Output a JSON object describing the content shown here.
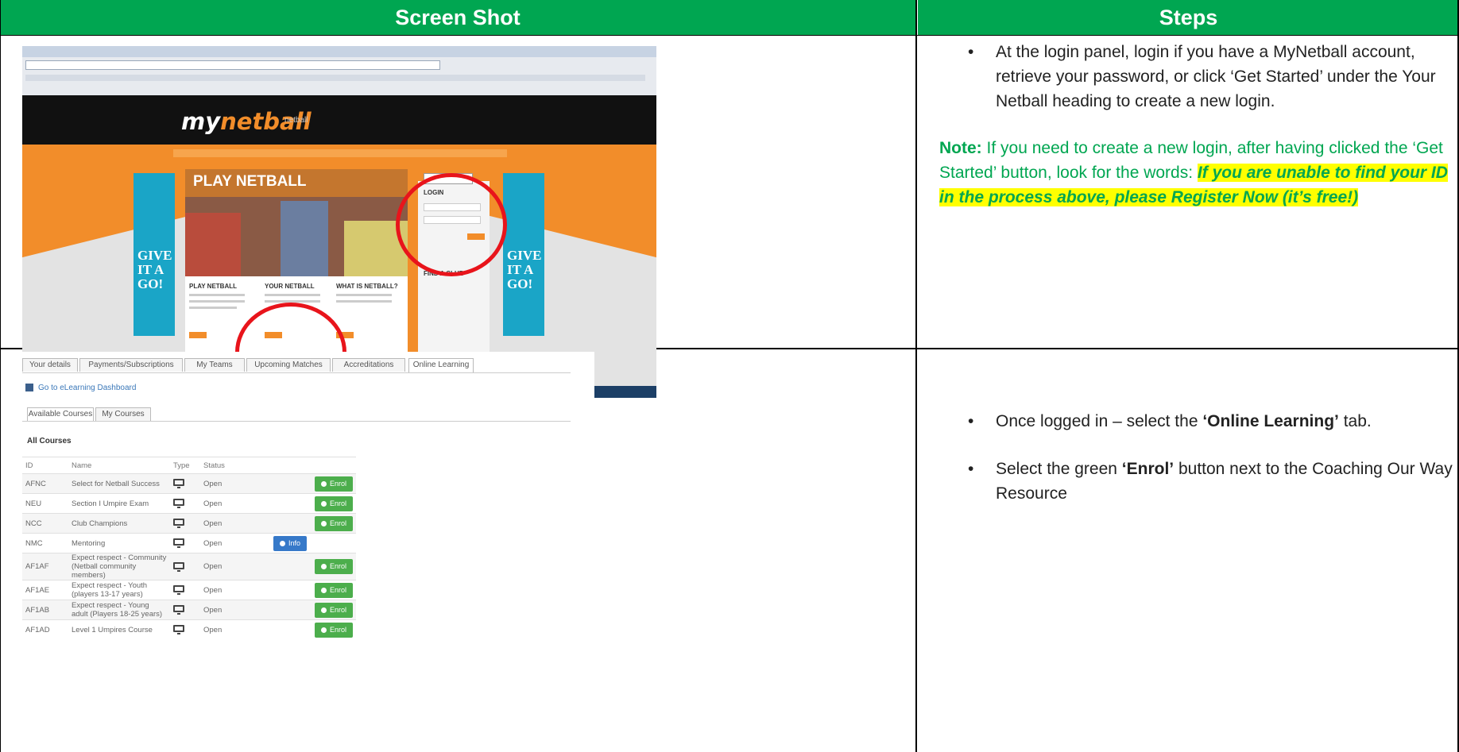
{
  "header": {
    "left": "Screen Shot",
    "right": "Steps"
  },
  "row1": {
    "step": "At the login panel, login if you have a MyNetball account, retrieve your password, or click ‘Get Started’ under the Your Netball heading to create a new login.",
    "note_label": "Note:",
    "note_text": "If you need to create a new login, after having clicked the ‘Get Started’ button, look for the words:",
    "note_highlight": "If you are unable to find your ID in the process above, please Register Now (it’s free!)",
    "screenshot": {
      "logo_prefix": "my",
      "logo_accent": "netball",
      "logo_sub": "netball",
      "play_title": "PLAY NETBALL",
      "banner_text": "GIVE IT A GO!",
      "login_label": "LOGIN",
      "find_club": "FIND A CLUB",
      "col_titles": [
        "PLAY NETBALL",
        "YOUR NETBALL",
        "WHAT IS NETBALL?"
      ]
    }
  },
  "row2": {
    "step1_pre": "Once logged in – select the ",
    "step1_bold": "‘Online Learning’",
    "step1_post": " tab.",
    "step2_pre": "Select the green ",
    "step2_bold": "‘Enrol’",
    "step2_post": " button next to the Coaching Our Way Resource",
    "tabs": [
      "Your details",
      "Payments/Subscriptions",
      "My Teams",
      "Upcoming Matches",
      "Accreditations",
      "Online Learning"
    ],
    "dashboard_link": "Go to eLearning Dashboard",
    "subtabs": [
      "Available Courses",
      "My Courses"
    ],
    "section_title": "All Courses",
    "table": {
      "headers": [
        "ID",
        "Name",
        "Type",
        "Status",
        ""
      ],
      "rows": [
        {
          "id": "AFNC",
          "name": "Select for Netball Success",
          "status": "Open",
          "action": "Enrol"
        },
        {
          "id": "NEU",
          "name": "Section I Umpire Exam",
          "status": "Open",
          "action": "Enrol"
        },
        {
          "id": "NCC",
          "name": "Club Champions",
          "status": "Open",
          "action": "Enrol"
        },
        {
          "id": "NMC",
          "name": "Mentoring",
          "status": "Open",
          "action": "Info"
        },
        {
          "id": "AF1AF",
          "name": "Expect respect - Community (Netball community members)",
          "status": "Open",
          "action": "Enrol"
        },
        {
          "id": "AF1AE",
          "name": "Expect respect - Youth (players 13-17 years)",
          "status": "Open",
          "action": "Enrol"
        },
        {
          "id": "AF1AB",
          "name": "Expect respect - Young adult (Players 18-25 years)",
          "status": "Open",
          "action": "Enrol"
        },
        {
          "id": "AF1AD",
          "name": "Level 1 Umpires Course",
          "status": "Open",
          "action": "Enrol"
        }
      ]
    }
  },
  "colors": {
    "header_green": "#00a651",
    "note_green": "#00a651",
    "highlight": "#ffff00",
    "circle_red": "#e8141b",
    "enrol_green": "#4cae4c",
    "info_blue": "#3679c9"
  }
}
